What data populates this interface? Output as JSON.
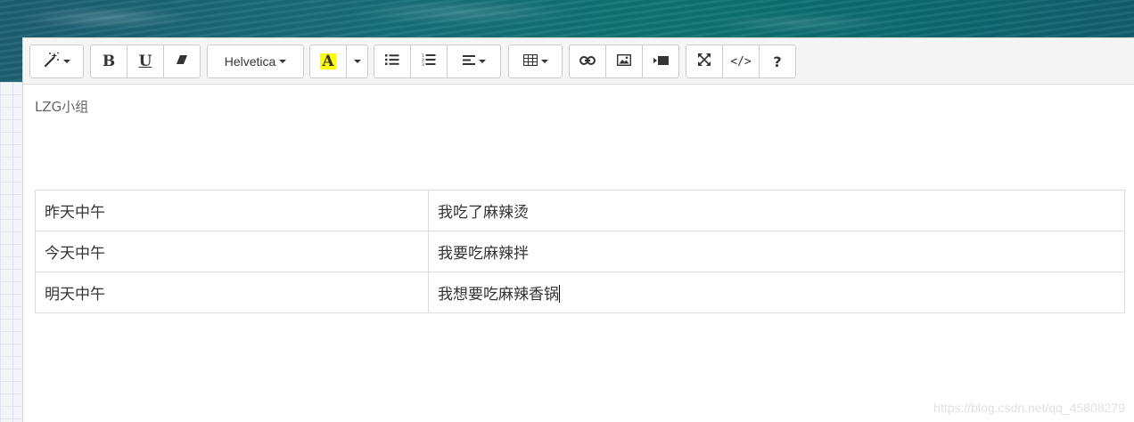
{
  "toolbar": {
    "style_dropdown": {
      "icon": "magic-wand-icon"
    },
    "format": {
      "bold": "B",
      "underline": "U",
      "clear_icon": "eraser-icon"
    },
    "font": {
      "name": "Helvetica"
    },
    "color": {
      "letter": "A",
      "highlight_color": "#ffff00"
    },
    "lists": {
      "unordered_icon": "unordered-list-icon",
      "ordered_icon": "ordered-list-icon",
      "align_icon": "align-left-icon"
    },
    "table": {
      "icon": "table-icon"
    },
    "insert": {
      "link_icon": "link-icon",
      "picture_icon": "picture-icon",
      "video_icon": "video-icon"
    },
    "view": {
      "fullscreen_icon": "fullscreen-icon",
      "code_label": "</>",
      "help_label": "?"
    }
  },
  "content": {
    "paragraph": "LZG小组",
    "table": {
      "rows": [
        [
          "昨天中午",
          "我吃了麻辣烫"
        ],
        [
          "今天中午",
          "我要吃麻辣拌"
        ],
        [
          "明天中午",
          "我想要吃麻辣香锅"
        ]
      ]
    }
  },
  "watermark": "https://blog.csdn.net/qq_45808279"
}
